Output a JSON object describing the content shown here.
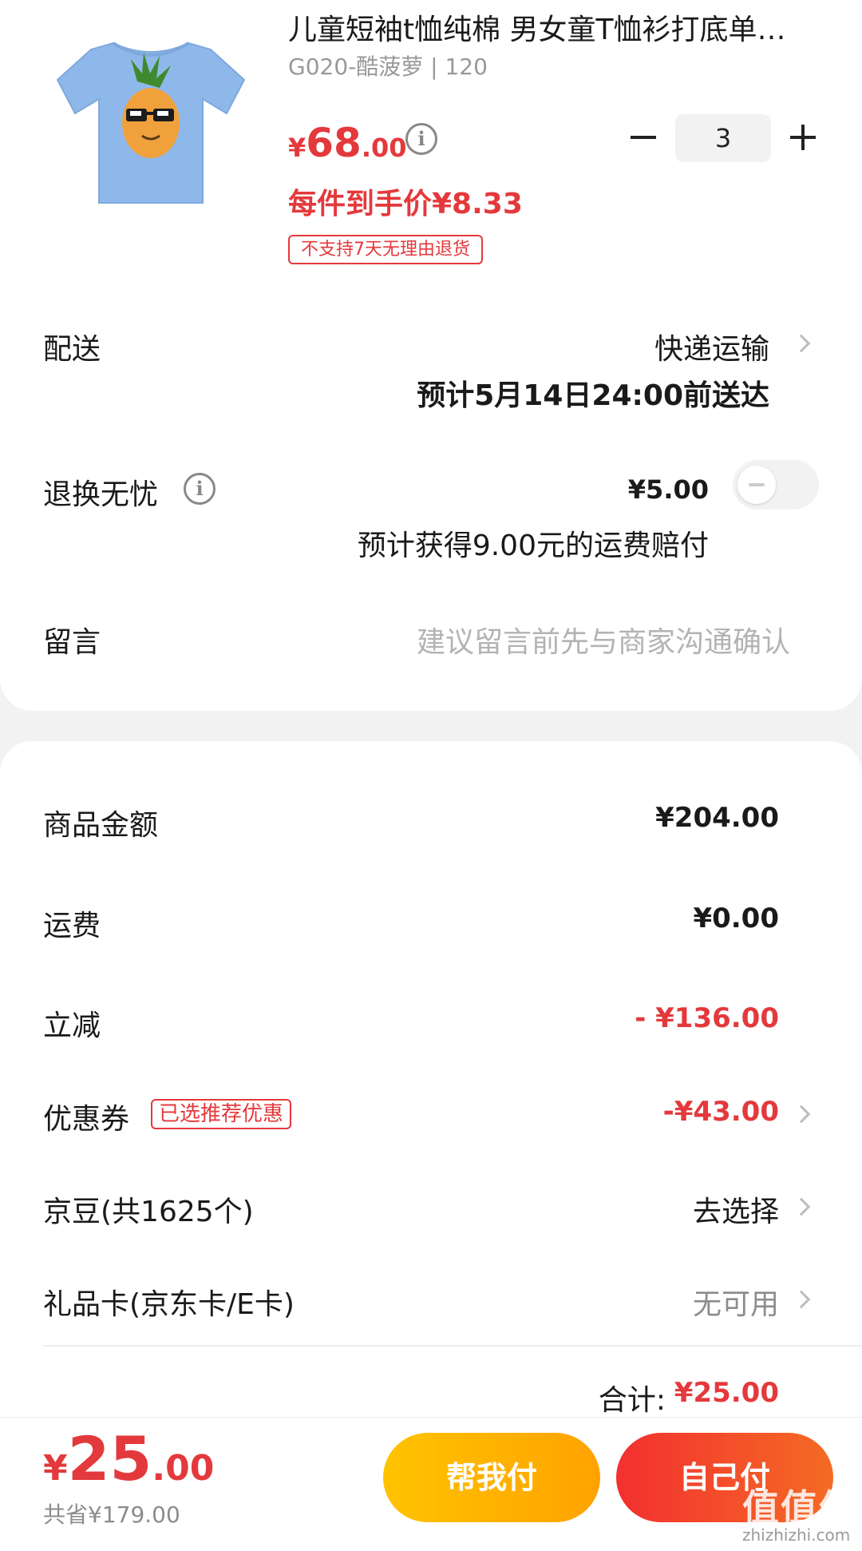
{
  "product": {
    "title": "儿童短袖t恤纯棉 男女童T恤衫打底单…",
    "spec": "G020-酷菠萝 | 120",
    "price_currency": "¥",
    "price_int": "68",
    "price_dec": ".00",
    "unit_price": "每件到手价¥8.33",
    "no_return_tag": "不支持7天无理由退货",
    "quantity": "3"
  },
  "delivery": {
    "label": "配送",
    "method": "快递运输",
    "eta": "预计5月14日24:00前送达"
  },
  "return_insurance": {
    "label": "退换无忧",
    "price": "¥5.00",
    "note": "预计获得9.00元的运费赔付",
    "enabled": false
  },
  "message": {
    "label": "留言",
    "placeholder": "建议留言前先与商家沟通确认"
  },
  "summary": {
    "goods_label": "商品金额",
    "goods_value": "¥204.00",
    "shipping_label": "运费",
    "shipping_value": "¥0.00",
    "discount_label": "立减",
    "discount_value": "- ¥136.00",
    "coupon_label": "优惠券",
    "coupon_tag": "已选推荐优惠",
    "coupon_value": "-¥43.00",
    "jd_beans_label": "京豆(共1625个)",
    "jd_beans_value": "去选择",
    "gift_card_label": "礼品卡(京东卡/E卡)",
    "gift_card_value": "无可用",
    "total_label": "合计:",
    "total_value": "¥25.00"
  },
  "bottom": {
    "currency": "¥",
    "pay_int": "25",
    "pay_dec": ".00",
    "saved": "共省¥179.00",
    "help_pay": "帮我付",
    "self_pay": "自己付"
  },
  "watermark": {
    "text": "值值值",
    "domain": "zhizhizhi.com"
  },
  "colors": {
    "accent_red": "#e4393c",
    "help_button": "#ffb400",
    "self_button": "#f23030"
  },
  "icons": [
    "tshirt-thumbnail",
    "info-icon",
    "minus-icon",
    "plus-icon",
    "chevron-right-icon",
    "toggle-switch"
  ]
}
